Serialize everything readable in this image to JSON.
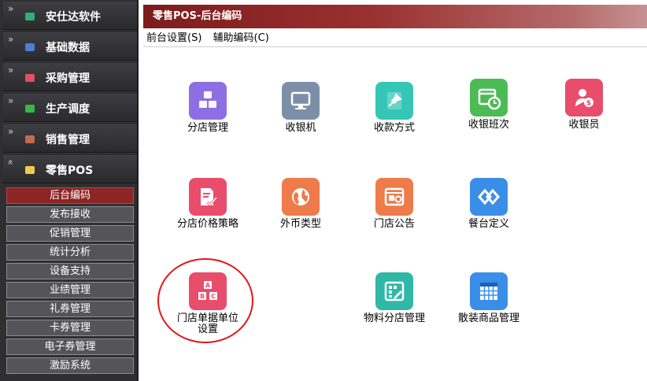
{
  "sidebar": {
    "modules": [
      {
        "label": "安仕达软件",
        "chevron": "»",
        "icon_color": "#2db07a"
      },
      {
        "label": "基础数据",
        "chevron": "»",
        "icon_color": "#4a7fd9"
      },
      {
        "label": "采购管理",
        "chevron": "»",
        "icon_color": "#e0505f"
      },
      {
        "label": "生产调度",
        "chevron": "»",
        "icon_color": "#39b54a"
      },
      {
        "label": "销售管理",
        "chevron": "»",
        "icon_color": "#c26a4f"
      },
      {
        "label": "零售POS",
        "chevron": "«",
        "icon_color": "#f2c94c"
      }
    ],
    "subitems": [
      {
        "label": "后台编码",
        "active": true
      },
      {
        "label": "发布接收"
      },
      {
        "label": "促销管理"
      },
      {
        "label": "统计分析"
      },
      {
        "label": "设备支持"
      },
      {
        "label": "业绩管理"
      },
      {
        "label": "礼券管理"
      },
      {
        "label": "卡券管理"
      },
      {
        "label": "电子券管理"
      },
      {
        "label": "激励系统"
      }
    ]
  },
  "main": {
    "title": "零售POS-后台编码",
    "menu": [
      "前台设置(S)",
      "辅助编码(C)"
    ],
    "tiles": [
      {
        "label": "分店管理",
        "icon": "cubes-icon",
        "color": "#8e6fe3"
      },
      {
        "label": "收银机",
        "icon": "monitor-icon",
        "color": "#7d8fa8"
      },
      {
        "label": "收款方式",
        "icon": "pin-icon",
        "color": "#35c6b8"
      },
      {
        "label": "收银班次",
        "icon": "calendar-clock-icon",
        "color": "#4dbb55"
      },
      {
        "label": "收银员",
        "icon": "cashier-icon",
        "color": "#e84d6c"
      },
      {
        "label": "分店价格策略",
        "icon": "document-edit-icon",
        "color": "#e84d6c"
      },
      {
        "label": "外币类型",
        "icon": "globe-icon",
        "color": "#ef7a4a"
      },
      {
        "label": "门店公告",
        "icon": "notice-icon",
        "color": "#ef7a4a"
      },
      {
        "label": "餐台定义",
        "icon": "diamond-link-icon",
        "color": "#3b8ee8"
      },
      {
        "label": "门店单据单位设置",
        "icon": "abc-blocks-icon",
        "color": "#e84d6c"
      },
      {
        "label": "物料分店管理",
        "icon": "grid-edit-icon",
        "color": "#2fb8a6"
      },
      {
        "label": "散装商品管理",
        "icon": "table-icon",
        "color": "#3b8ee8"
      }
    ]
  }
}
